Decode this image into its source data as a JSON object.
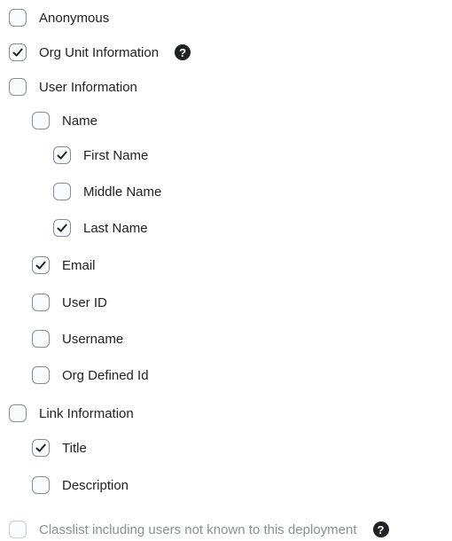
{
  "options": [
    {
      "key": "anonymous",
      "label": "Anonymous",
      "checked": false
    },
    {
      "key": "org_unit_info",
      "label": "Org Unit Information",
      "checked": true,
      "help_glyph": "?"
    },
    {
      "key": "user_info",
      "label": "User Information",
      "checked": false
    },
    {
      "key": "name",
      "label": "Name",
      "checked": false
    },
    {
      "key": "first_name",
      "label": "First Name",
      "checked": true
    },
    {
      "key": "middle_name",
      "label": "Middle Name",
      "checked": false
    },
    {
      "key": "last_name",
      "label": "Last Name",
      "checked": true
    },
    {
      "key": "email",
      "label": "Email",
      "checked": true
    },
    {
      "key": "user_id",
      "label": "User ID",
      "checked": false
    },
    {
      "key": "username",
      "label": "Username",
      "checked": false
    },
    {
      "key": "org_defined_id",
      "label": "Org Defined Id",
      "checked": false
    },
    {
      "key": "link_info",
      "label": "Link Information",
      "checked": false
    },
    {
      "key": "title",
      "label": "Title",
      "checked": true
    },
    {
      "key": "description",
      "label": "Description",
      "checked": false
    },
    {
      "key": "classlist_unknown_users",
      "label": "Classlist including users not known to this deployment",
      "checked": false,
      "disabled": true,
      "help_glyph": "?"
    }
  ],
  "icons": {
    "check": "check-icon",
    "help": "help-icon"
  },
  "colors": {
    "text": "#202122",
    "checkbox_border": "#868c8f",
    "disabled_text": "#8a9094"
  }
}
